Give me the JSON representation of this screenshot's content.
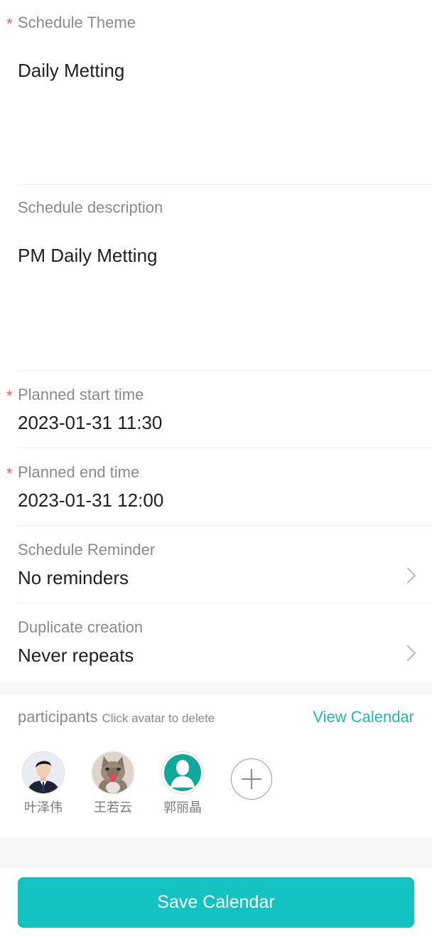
{
  "fields": {
    "theme": {
      "required": "*",
      "label": "Schedule Theme",
      "value": "Daily Metting"
    },
    "description": {
      "label": "Schedule description",
      "value": "PM Daily Metting"
    },
    "start_time": {
      "required": "*",
      "label": "Planned start time",
      "value": "2023-01-31 11:30"
    },
    "end_time": {
      "required": "*",
      "label": "Planned end time",
      "value": "2023-01-31 12:00"
    },
    "reminder": {
      "label": "Schedule Reminder",
      "value": "No reminders",
      "icon": "chevron-right-icon"
    },
    "repeat": {
      "label": "Duplicate creation",
      "value": "Never repeats",
      "icon": "chevron-right-icon"
    }
  },
  "participants": {
    "title": "participants",
    "hint": "Click avatar to delete",
    "view_calendar": "View Calendar",
    "people": [
      {
        "name": "叶泽伟",
        "avatar": "person-suit-photo"
      },
      {
        "name": "王若云",
        "avatar": "kitten-photo"
      },
      {
        "name": "郭丽晶",
        "avatar": "default-user-icon"
      }
    ],
    "add_icon": "plus-icon"
  },
  "footer": {
    "save_label": "Save Calendar"
  },
  "colors": {
    "accent": "#14c2c2",
    "link": "#20b8b4",
    "required": "#f15a4a"
  }
}
